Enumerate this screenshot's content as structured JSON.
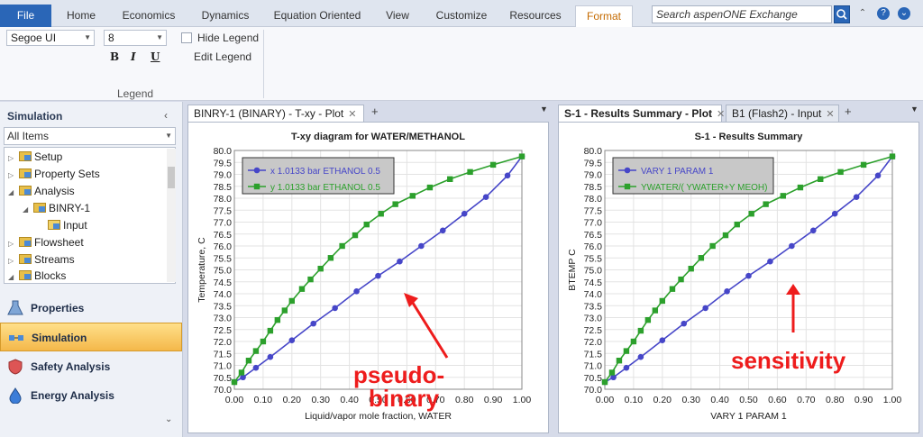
{
  "ribbon": {
    "tabs": [
      "File",
      "Home",
      "Economics",
      "Dynamics",
      "Equation Oriented",
      "View",
      "Customize",
      "Resources",
      "Format"
    ],
    "search_placeholder": "Search aspenONE Exchange",
    "font_name": "Segoe UI",
    "font_size": "8",
    "bold": "B",
    "italic": "I",
    "underline": "U",
    "hide_legend": "Hide Legend",
    "edit_legend": "Edit Legend",
    "group_label": "Legend"
  },
  "nav": {
    "title": "Simulation",
    "filter": "All Items",
    "tree": [
      "Setup",
      "Property Sets",
      "Analysis",
      "BINRY-1",
      "Input",
      "Flowsheet",
      "Streams",
      "Blocks"
    ],
    "buttons": [
      "Properties",
      "Simulation",
      "Safety Analysis",
      "Energy Analysis"
    ]
  },
  "left_pane": {
    "tab": "BINRY-1 (BINARY) - T-xy - Plot",
    "plus": "+"
  },
  "right_pane": {
    "tab_active": "S-1 - Results Summary - Plot",
    "tab_other": "B1 (Flash2) - Input",
    "plus": "+"
  },
  "chart_data": [
    {
      "type": "line",
      "title": "T-xy diagram for WATER/METHANOL",
      "xlabel": "Liquid/vapor mole fraction, WATER",
      "ylabel": "Temperature, C",
      "xlim": [
        0,
        1
      ],
      "ylim": [
        70,
        80
      ],
      "x_ticks": [
        "0.00",
        "0.10",
        "0.20",
        "0.30",
        "0.40",
        "0.50",
        "0.60",
        "0.70",
        "0.80",
        "0.90",
        "1.00"
      ],
      "y_ticks": [
        "70.0",
        "70.5",
        "71.0",
        "71.5",
        "72.0",
        "72.5",
        "73.0",
        "73.5",
        "74.0",
        "74.5",
        "75.0",
        "75.5",
        "76.0",
        "76.5",
        "77.0",
        "77.5",
        "78.0",
        "78.5",
        "79.0",
        "79.5",
        "80.0"
      ],
      "grid": true,
      "legend": "top-left",
      "series": [
        {
          "name": "x  1.0133 bar ETHANOL 0.5",
          "color": "#4646c8",
          "x": [
            0,
            0.03,
            0.075,
            0.125,
            0.2,
            0.275,
            0.35,
            0.425,
            0.5,
            0.575,
            0.65,
            0.725,
            0.8,
            0.875,
            0.95,
            1.0
          ],
          "y": [
            70.3,
            70.5,
            70.9,
            71.35,
            72.05,
            72.75,
            73.4,
            74.1,
            74.75,
            75.35,
            76.0,
            76.65,
            77.35,
            78.05,
            78.95,
            79.75
          ]
        },
        {
          "name": "y  1.0133 bar ETHANOL 0.5",
          "color": "#2ca02c",
          "x": [
            0,
            0.025,
            0.05,
            0.075,
            0.1,
            0.125,
            0.15,
            0.175,
            0.2,
            0.235,
            0.265,
            0.3,
            0.335,
            0.375,
            0.42,
            0.46,
            0.51,
            0.56,
            0.62,
            0.68,
            0.75,
            0.82,
            0.9,
            1.0
          ],
          "y": [
            70.3,
            70.7,
            71.2,
            71.6,
            72.0,
            72.45,
            72.9,
            73.3,
            73.7,
            74.2,
            74.6,
            75.05,
            75.5,
            76.0,
            76.45,
            76.9,
            77.35,
            77.75,
            78.1,
            78.45,
            78.8,
            79.1,
            79.4,
            79.75
          ]
        }
      ]
    },
    {
      "type": "line",
      "title": "S-1 - Results Summary",
      "xlabel": "VARY  1 PARAM   1",
      "ylabel": "BTEMP   C",
      "xlim": [
        0,
        1
      ],
      "ylim": [
        70,
        80
      ],
      "x_ticks": [
        "0.00",
        "0.10",
        "0.20",
        "0.30",
        "0.40",
        "0.50",
        "0.60",
        "0.70",
        "0.80",
        "0.90",
        "1.00"
      ],
      "y_ticks": [
        "70.0",
        "70.5",
        "71.0",
        "71.5",
        "72.0",
        "72.5",
        "73.0",
        "73.5",
        "74.0",
        "74.5",
        "75.0",
        "75.5",
        "76.0",
        "76.5",
        "77.0",
        "77.5",
        "78.0",
        "78.5",
        "79.0",
        "79.5",
        "80.0"
      ],
      "grid": true,
      "legend": "top-left",
      "series": [
        {
          "name": "VARY  1 PARAM   1",
          "color": "#4646c8",
          "x": [
            0,
            0.03,
            0.075,
            0.125,
            0.2,
            0.275,
            0.35,
            0.425,
            0.5,
            0.575,
            0.65,
            0.725,
            0.8,
            0.875,
            0.95,
            1.0
          ],
          "y": [
            70.3,
            70.5,
            70.9,
            71.35,
            72.05,
            72.75,
            73.4,
            74.1,
            74.75,
            75.35,
            76.0,
            76.65,
            77.35,
            78.05,
            78.95,
            79.75
          ]
        },
        {
          "name": "YWATER/( YWATER+Y MEOH)",
          "color": "#2ca02c",
          "x": [
            0,
            0.025,
            0.05,
            0.075,
            0.1,
            0.125,
            0.15,
            0.175,
            0.2,
            0.235,
            0.265,
            0.3,
            0.335,
            0.375,
            0.42,
            0.46,
            0.51,
            0.56,
            0.62,
            0.68,
            0.75,
            0.82,
            0.9,
            1.0
          ],
          "y": [
            70.3,
            70.7,
            71.2,
            71.6,
            72.0,
            72.45,
            72.9,
            73.3,
            73.7,
            74.2,
            74.6,
            75.05,
            75.5,
            76.0,
            76.45,
            76.9,
            77.35,
            77.75,
            78.1,
            78.45,
            78.8,
            79.1,
            79.4,
            79.75
          ]
        }
      ]
    }
  ],
  "annotations": {
    "left_line1": "pseudo-",
    "left_line2": "binary",
    "right": "sensitivity",
    "color": "#ee1c1c"
  }
}
